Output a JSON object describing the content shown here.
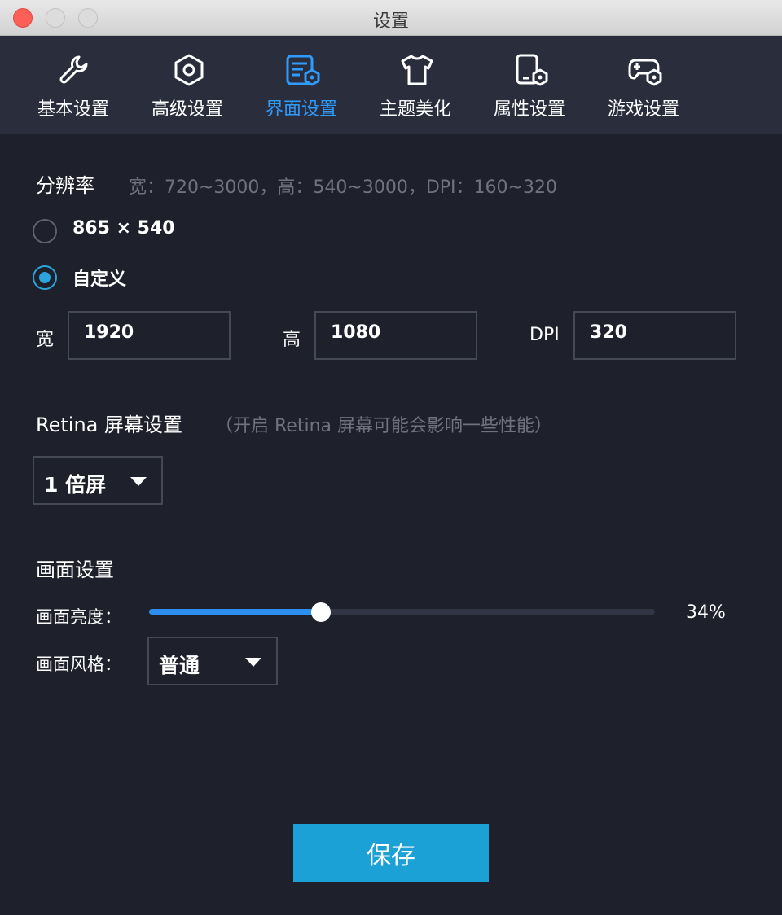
{
  "window": {
    "title": "设置"
  },
  "tabs": [
    {
      "label": "基本设置",
      "icon": "wrench-icon",
      "active": false
    },
    {
      "label": "高级设置",
      "icon": "hexagon-nut-icon",
      "active": false
    },
    {
      "label": "界面设置",
      "icon": "interface-settings-icon",
      "active": true
    },
    {
      "label": "主题美化",
      "icon": "tshirt-icon",
      "active": false
    },
    {
      "label": "属性设置",
      "icon": "device-settings-icon",
      "active": false
    },
    {
      "label": "游戏设置",
      "icon": "gamepad-settings-icon",
      "active": false
    }
  ],
  "resolution": {
    "title": "分辨率",
    "hint": "宽：720~3000，高：540~3000，DPI：160~320",
    "options": [
      {
        "label": "865 × 540",
        "checked": false
      },
      {
        "label": "自定义",
        "checked": true
      }
    ],
    "width_label": "宽",
    "width_value": "1920",
    "height_label": "高",
    "height_value": "1080",
    "dpi_label": "DPI",
    "dpi_value": "320"
  },
  "retina": {
    "title": "Retina 屏幕设置",
    "hint": "（开启 Retina 屏幕可能会影响一些性能）",
    "selected": "1 倍屏"
  },
  "display": {
    "title": "画面设置",
    "brightness_label": "画面亮度：",
    "brightness_value": 34,
    "brightness_text": "34%",
    "style_label": "画面风格：",
    "style_selected": "普通"
  },
  "save_label": "保存",
  "colors": {
    "background": "#1e202b",
    "tabbar": "#2a2e3c",
    "accent_tab": "#2e9bff",
    "radio_checked": "#2aa5dc",
    "slider_fill": "#2d8ef0",
    "save_button": "#1ba1d5"
  }
}
